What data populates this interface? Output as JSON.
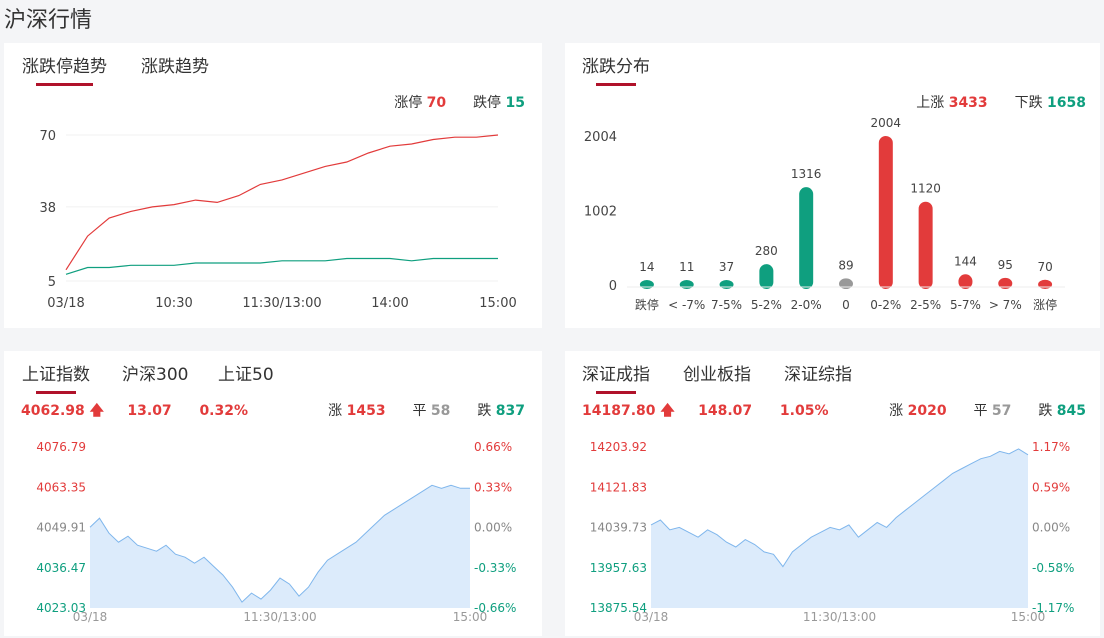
{
  "page": {
    "title": "沪深行情"
  },
  "colors": {
    "up": "#e23b3b",
    "down": "#0f9f7f",
    "flat": "#999999",
    "accent": "#b0122a",
    "area": "#dcebfb",
    "area_line": "#7fb6ec"
  },
  "limit_trend": {
    "tabs": [
      {
        "label": "涨跌停趋势",
        "active": true
      },
      {
        "label": "涨跌趋势",
        "active": false
      }
    ],
    "limit_up_label": "涨停",
    "limit_up_value": "70",
    "limit_down_label": "跌停",
    "limit_down_value": "15"
  },
  "distribution": {
    "tabs": [
      {
        "label": "涨跌分布",
        "active": true
      }
    ],
    "up_label": "上涨",
    "up_value": "3433",
    "down_label": "下跌",
    "down_value": "1658"
  },
  "sh_index": {
    "tabs": [
      {
        "label": "上证指数",
        "active": true
      },
      {
        "label": "沪深300",
        "active": false
      },
      {
        "label": "上证50",
        "active": false
      }
    ],
    "price": "4062.98",
    "change": "13.07",
    "change_pct": "0.32%",
    "up_label": "涨",
    "up_count": "1453",
    "flat_label": "平",
    "flat_count": "58",
    "down_label": "跌",
    "down_count": "837",
    "arrow_icon": "up-arrow-icon"
  },
  "sz_index": {
    "tabs": [
      {
        "label": "深证成指",
        "active": true
      },
      {
        "label": "创业板指",
        "active": false
      },
      {
        "label": "深证综指",
        "active": false
      }
    ],
    "price": "14187.80",
    "change": "148.07",
    "change_pct": "1.05%",
    "up_label": "涨",
    "up_count": "2020",
    "flat_label": "平",
    "flat_count": "57",
    "down_label": "跌",
    "down_count": "845",
    "arrow_icon": "up-arrow-icon"
  },
  "chart_data": [
    {
      "type": "line",
      "x_ticks": [
        "03/18",
        "10:30",
        "11:30/13:00",
        "14:00",
        "15:00"
      ],
      "y_ticks": [
        "70",
        "38",
        "5"
      ],
      "ylim": [
        5,
        70
      ],
      "series": [
        {
          "name": "涨停",
          "color": "#e23b3b",
          "points": [
            [
              0,
              10
            ],
            [
              0.05,
              25
            ],
            [
              0.1,
              33
            ],
            [
              0.15,
              36
            ],
            [
              0.2,
              38
            ],
            [
              0.25,
              39
            ],
            [
              0.3,
              41
            ],
            [
              0.35,
              40
            ],
            [
              0.4,
              43
            ],
            [
              0.45,
              48
            ],
            [
              0.5,
              50
            ],
            [
              0.55,
              53
            ],
            [
              0.6,
              56
            ],
            [
              0.65,
              58
            ],
            [
              0.7,
              62
            ],
            [
              0.75,
              65
            ],
            [
              0.8,
              66
            ],
            [
              0.85,
              68
            ],
            [
              0.9,
              69
            ],
            [
              0.95,
              69
            ],
            [
              1,
              70
            ]
          ]
        },
        {
          "name": "跌停",
          "color": "#0f9f7f",
          "points": [
            [
              0,
              8
            ],
            [
              0.05,
              11
            ],
            [
              0.1,
              11
            ],
            [
              0.15,
              12
            ],
            [
              0.2,
              12
            ],
            [
              0.25,
              12
            ],
            [
              0.3,
              13
            ],
            [
              0.35,
              13
            ],
            [
              0.4,
              13
            ],
            [
              0.45,
              13
            ],
            [
              0.5,
              14
            ],
            [
              0.55,
              14
            ],
            [
              0.6,
              14
            ],
            [
              0.65,
              15
            ],
            [
              0.7,
              15
            ],
            [
              0.75,
              15
            ],
            [
              0.8,
              14
            ],
            [
              0.85,
              15
            ],
            [
              0.9,
              15
            ],
            [
              0.95,
              15
            ],
            [
              1,
              15
            ]
          ]
        }
      ]
    },
    {
      "type": "bar",
      "categories": [
        "跌停",
        "< -7%",
        "7-5%",
        "5-2%",
        "2-0%",
        "0",
        "0-2%",
        "2-5%",
        "5-7%",
        "> 7%",
        "涨停"
      ],
      "values": [
        14,
        11,
        37,
        280,
        1316,
        89,
        2004,
        1120,
        144,
        95,
        70
      ],
      "bar_colors": [
        "#0f9f7f",
        "#0f9f7f",
        "#0f9f7f",
        "#0f9f7f",
        "#0f9f7f",
        "#999999",
        "#e23b3b",
        "#e23b3b",
        "#e23b3b",
        "#e23b3b",
        "#e23b3b"
      ],
      "y_ticks": [
        "2004",
        "1002",
        "0"
      ],
      "ylim": [
        0,
        2004
      ]
    },
    {
      "type": "area",
      "y_ticks": [
        "4076.79",
        "4063.35",
        "4049.91",
        "4036.47",
        "4023.03"
      ],
      "right_ticks": [
        "0.66%",
        "0.33%",
        "0.00%",
        "-0.33%",
        "-0.66%"
      ],
      "x_ticks": [
        "03/18",
        "11:30/13:00",
        "15:00"
      ],
      "ylim": [
        4023.03,
        4076.79
      ],
      "values": [
        4050,
        4053,
        4048,
        4045,
        4047,
        4044,
        4043,
        4042,
        4044,
        4041,
        4040,
        4038,
        4040,
        4037,
        4034,
        4030,
        4025,
        4028,
        4026,
        4029,
        4033,
        4031,
        4027,
        4030,
        4035,
        4039,
        4041,
        4043,
        4045,
        4048,
        4051,
        4054,
        4056,
        4058,
        4060,
        4062,
        4064,
        4063,
        4064,
        4063,
        4063
      ]
    },
    {
      "type": "area",
      "y_ticks": [
        "14203.92",
        "14121.83",
        "14039.73",
        "13957.63",
        "13875.54"
      ],
      "right_ticks": [
        "1.17%",
        "0.59%",
        "0.00%",
        "-0.58%",
        "-1.17%"
      ],
      "x_ticks": [
        "03/18",
        "11:30/13:00",
        "15:00"
      ],
      "ylim": [
        13875.54,
        14203.92
      ],
      "values": [
        14045,
        14055,
        14035,
        14040,
        14030,
        14020,
        14035,
        14025,
        14010,
        14000,
        14015,
        14005,
        13990,
        13985,
        13960,
        13990,
        14005,
        14020,
        14030,
        14040,
        14035,
        14045,
        14020,
        14035,
        14050,
        14040,
        14060,
        14075,
        14090,
        14105,
        14120,
        14135,
        14150,
        14160,
        14170,
        14180,
        14185,
        14195,
        14190,
        14200,
        14188
      ]
    }
  ]
}
